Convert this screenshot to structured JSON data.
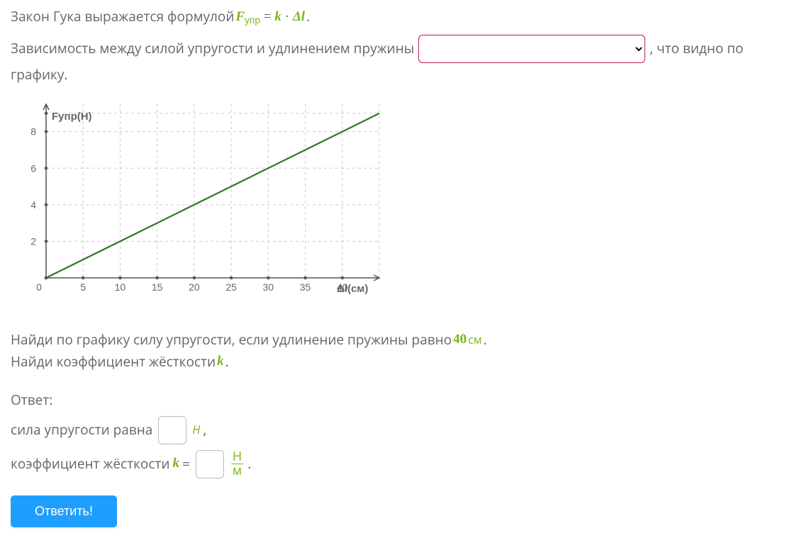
{
  "intro": {
    "text_before": "Закон Гука выражается формулой ",
    "formula_F": "F",
    "formula_sub": "упр",
    "formula_eq": " = ",
    "formula_k": "k",
    "formula_dot": " · ",
    "formula_delta": "Δ",
    "formula_l": "l",
    "text_after": "."
  },
  "dependency": {
    "before": "Зависимость между силой упругости и удлинением пружины ",
    "after_comma": ", что видно по",
    "after2": "графику."
  },
  "chart_data": {
    "type": "line",
    "title": "",
    "xlabel": "Δl(см)",
    "ylabel": "Fупр(Н)",
    "x_ticks": [
      0,
      5,
      10,
      15,
      20,
      25,
      30,
      35,
      40
    ],
    "y_ticks": [
      0,
      2,
      4,
      6,
      8
    ],
    "xlim": [
      0,
      45
    ],
    "ylim": [
      0,
      9.5
    ],
    "series": [
      {
        "name": "Fупр",
        "x": [
          0,
          45
        ],
        "values": [
          0,
          9
        ]
      }
    ]
  },
  "task": {
    "line1_before": "Найди по графику силу упругости, если удлинение пружины равно ",
    "line1_value": "40",
    "line1_unit": "см",
    "line1_after": ".",
    "line2_before": "Найди коэффициент жёсткости ",
    "line2_k": "k",
    "line2_after": "."
  },
  "answer": {
    "header": "Ответ:",
    "force_before": "сила упругости равна ",
    "force_unit": "Н",
    "force_after": ",",
    "coeff_before": "коэффициент жёсткости ",
    "coeff_k": "k",
    "coeff_eq": " = ",
    "frac_num": "Н",
    "frac_den": "м",
    "coeff_after": "."
  },
  "button": "Ответить!"
}
